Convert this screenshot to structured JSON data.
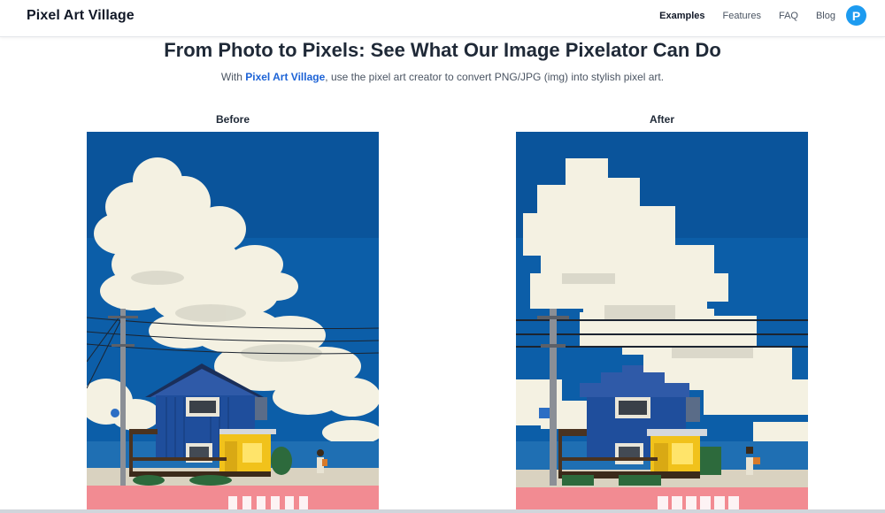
{
  "header": {
    "brand": "Pixel Art Village",
    "nav": [
      {
        "label": "Examples",
        "active": true
      },
      {
        "label": "Features",
        "active": false
      },
      {
        "label": "FAQ",
        "active": false
      },
      {
        "label": "Blog",
        "active": false
      }
    ],
    "avatar_initial": "P"
  },
  "hero": {
    "title": "From Photo to Pixels: See What Our Image Pixelator Can Do",
    "subtitle_prefix": "With ",
    "subtitle_link": "Pixel Art Village",
    "subtitle_suffix": ", use the pixel art creator to convert PNG/JPG (img) into stylish pixel art."
  },
  "comparison": {
    "before_label": "Before",
    "after_label": "After"
  },
  "colors": {
    "sky": "#0c5ea8",
    "cloud": "#f4f1e2",
    "house": "#1f4e9c",
    "door": "#f1c21b",
    "avatar": "#1d9bf0",
    "link": "#1d63d6"
  }
}
